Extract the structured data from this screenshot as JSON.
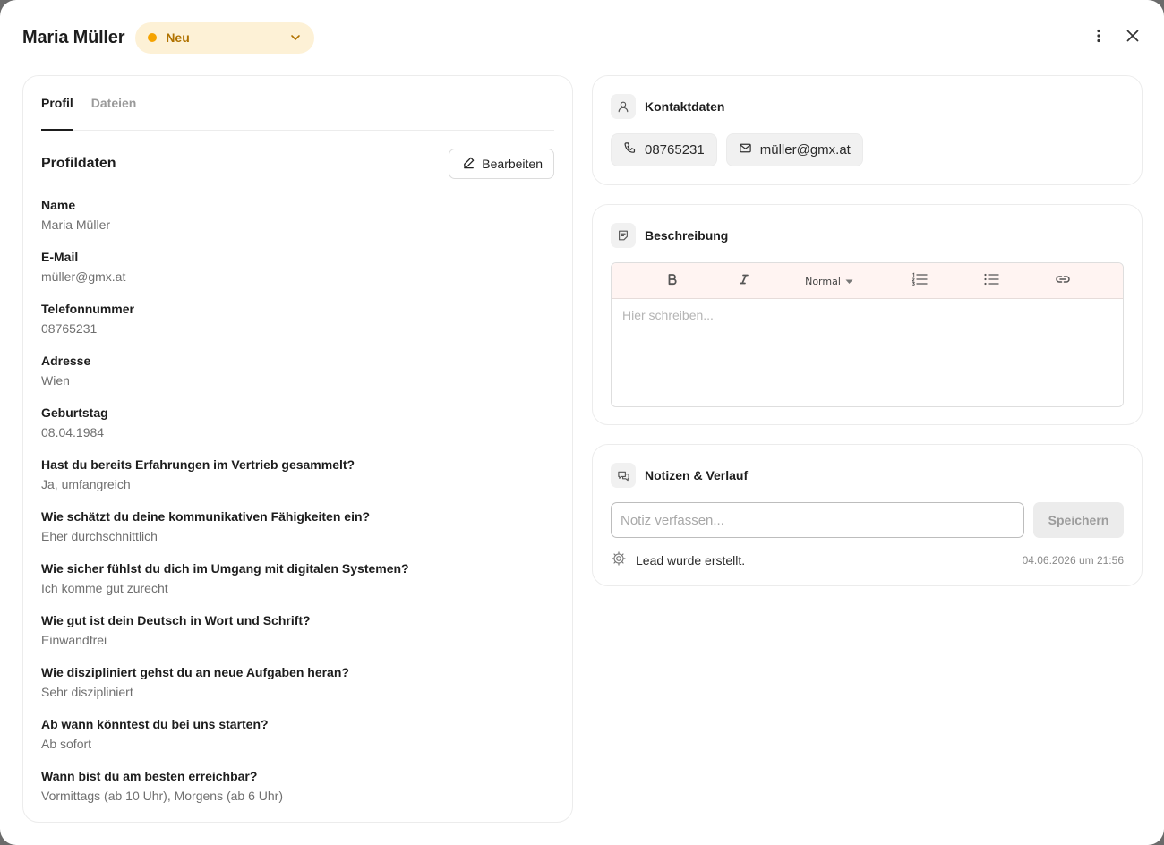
{
  "header": {
    "lead_name": "Maria Müller",
    "status": {
      "label": "Neu",
      "color": "#f5a300"
    }
  },
  "profile": {
    "tabs": [
      {
        "label": "Profil",
        "active": true
      },
      {
        "label": "Dateien",
        "active": false
      }
    ],
    "section_title": "Profildaten",
    "edit_label": "Bearbeiten",
    "fields": [
      {
        "label": "Name",
        "value": "Maria Müller"
      },
      {
        "label": "E-Mail",
        "value": "müller@gmx.at"
      },
      {
        "label": "Telefonnummer",
        "value": "08765231"
      },
      {
        "label": "Adresse",
        "value": "Wien"
      },
      {
        "label": "Geburtstag",
        "value": "08.04.1984"
      },
      {
        "label": "Hast du bereits Erfahrungen im Vertrieb gesammelt?",
        "value": "Ja, umfangreich"
      },
      {
        "label": "Wie schätzt du deine kommunikativen Fähigkeiten ein?",
        "value": "Eher durchschnittlich"
      },
      {
        "label": "Wie sicher fühlst du dich im Umgang mit digitalen Systemen?",
        "value": "Ich komme gut zurecht"
      },
      {
        "label": "Wie gut ist dein Deutsch in Wort und Schrift?",
        "value": "Einwandfrei"
      },
      {
        "label": "Wie diszipliniert gehst du an neue Aufgaben heran?",
        "value": "Sehr diszipliniert"
      },
      {
        "label": "Ab wann könntest du bei uns starten?",
        "value": "Ab sofort"
      },
      {
        "label": "Wann bist du am besten erreichbar?",
        "value": "Vormittags (ab 10 Uhr), Morgens (ab 6 Uhr)"
      }
    ]
  },
  "contact": {
    "title": "Kontaktdaten",
    "phone": "08765231",
    "email": "müller@gmx.at"
  },
  "description": {
    "title": "Beschreibung",
    "format_select": "Normal",
    "placeholder": "Hier schreiben..."
  },
  "notes": {
    "title": "Notizen & Verlauf",
    "input_placeholder": "Notiz verfassen...",
    "save_label": "Speichern",
    "history": [
      {
        "text": "Lead wurde erstellt.",
        "time": "04.06.2026 um 21:56"
      }
    ]
  }
}
